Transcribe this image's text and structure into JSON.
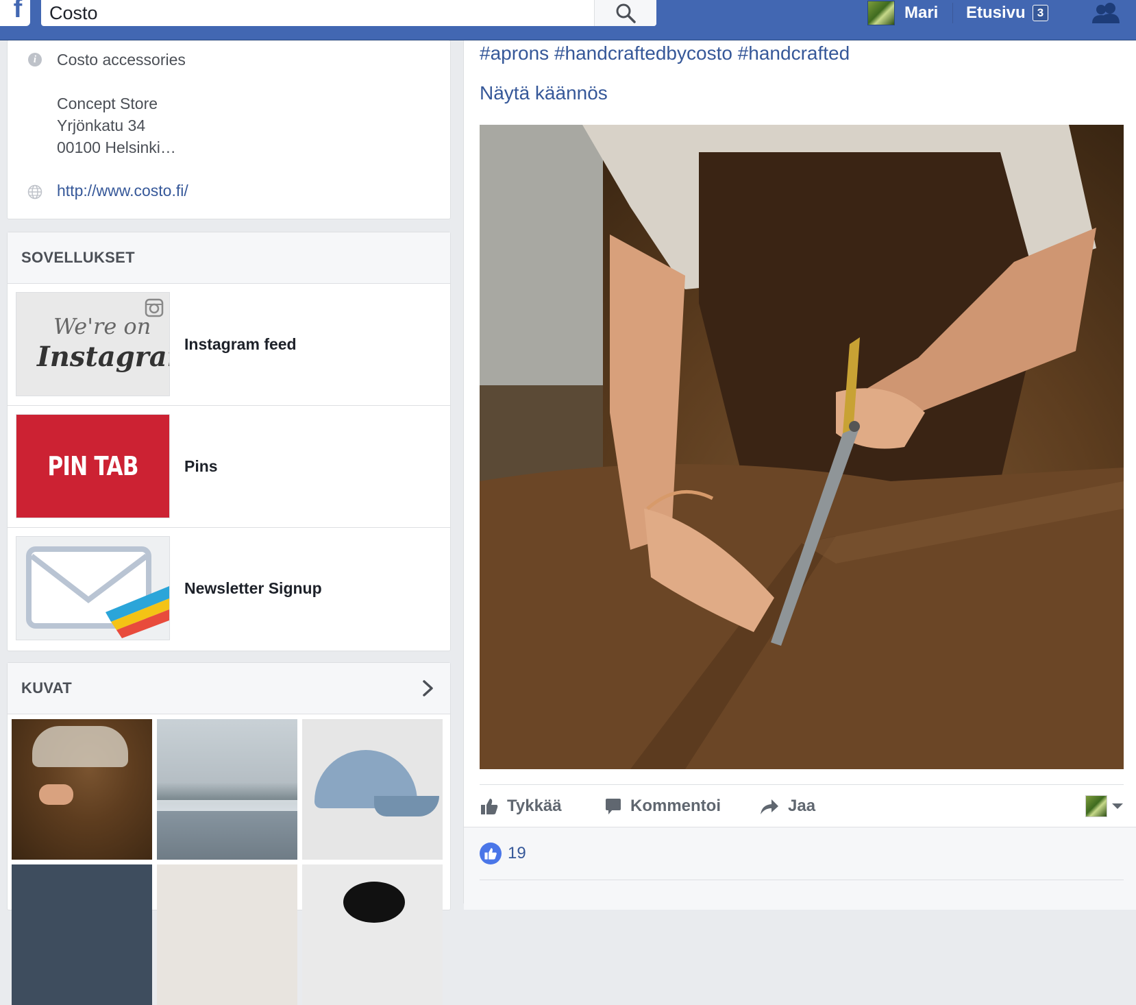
{
  "topbar": {
    "search_value": "Costo",
    "user_name": "Mari",
    "home_label": "Etusivu",
    "home_badge": "3",
    "brand_color": "#4267b2"
  },
  "about": {
    "category": "Costo accessories",
    "address_lines": [
      "Concept Store",
      "Yrjönkatu 34",
      "00100 Helsinki…"
    ],
    "website": "http://www.costo.fi/"
  },
  "apps": {
    "header": "SOVELLUKSET",
    "items": [
      {
        "label": "Instagram feed",
        "thumb_text_1": "We're on",
        "thumb_text_2": "Instagram"
      },
      {
        "label": "Pins",
        "thumb_text": "PIN TAB"
      },
      {
        "label": "Newsletter Signup"
      }
    ]
  },
  "photos": {
    "header": "KUVAT"
  },
  "post": {
    "hashtags": "#aprons #handcraftedbycosto #handcrafted",
    "translate_link": "Näytä käännös",
    "actions": {
      "like": "Tykkää",
      "comment": "Kommentoi",
      "share": "Jaa"
    },
    "like_count": "19"
  }
}
